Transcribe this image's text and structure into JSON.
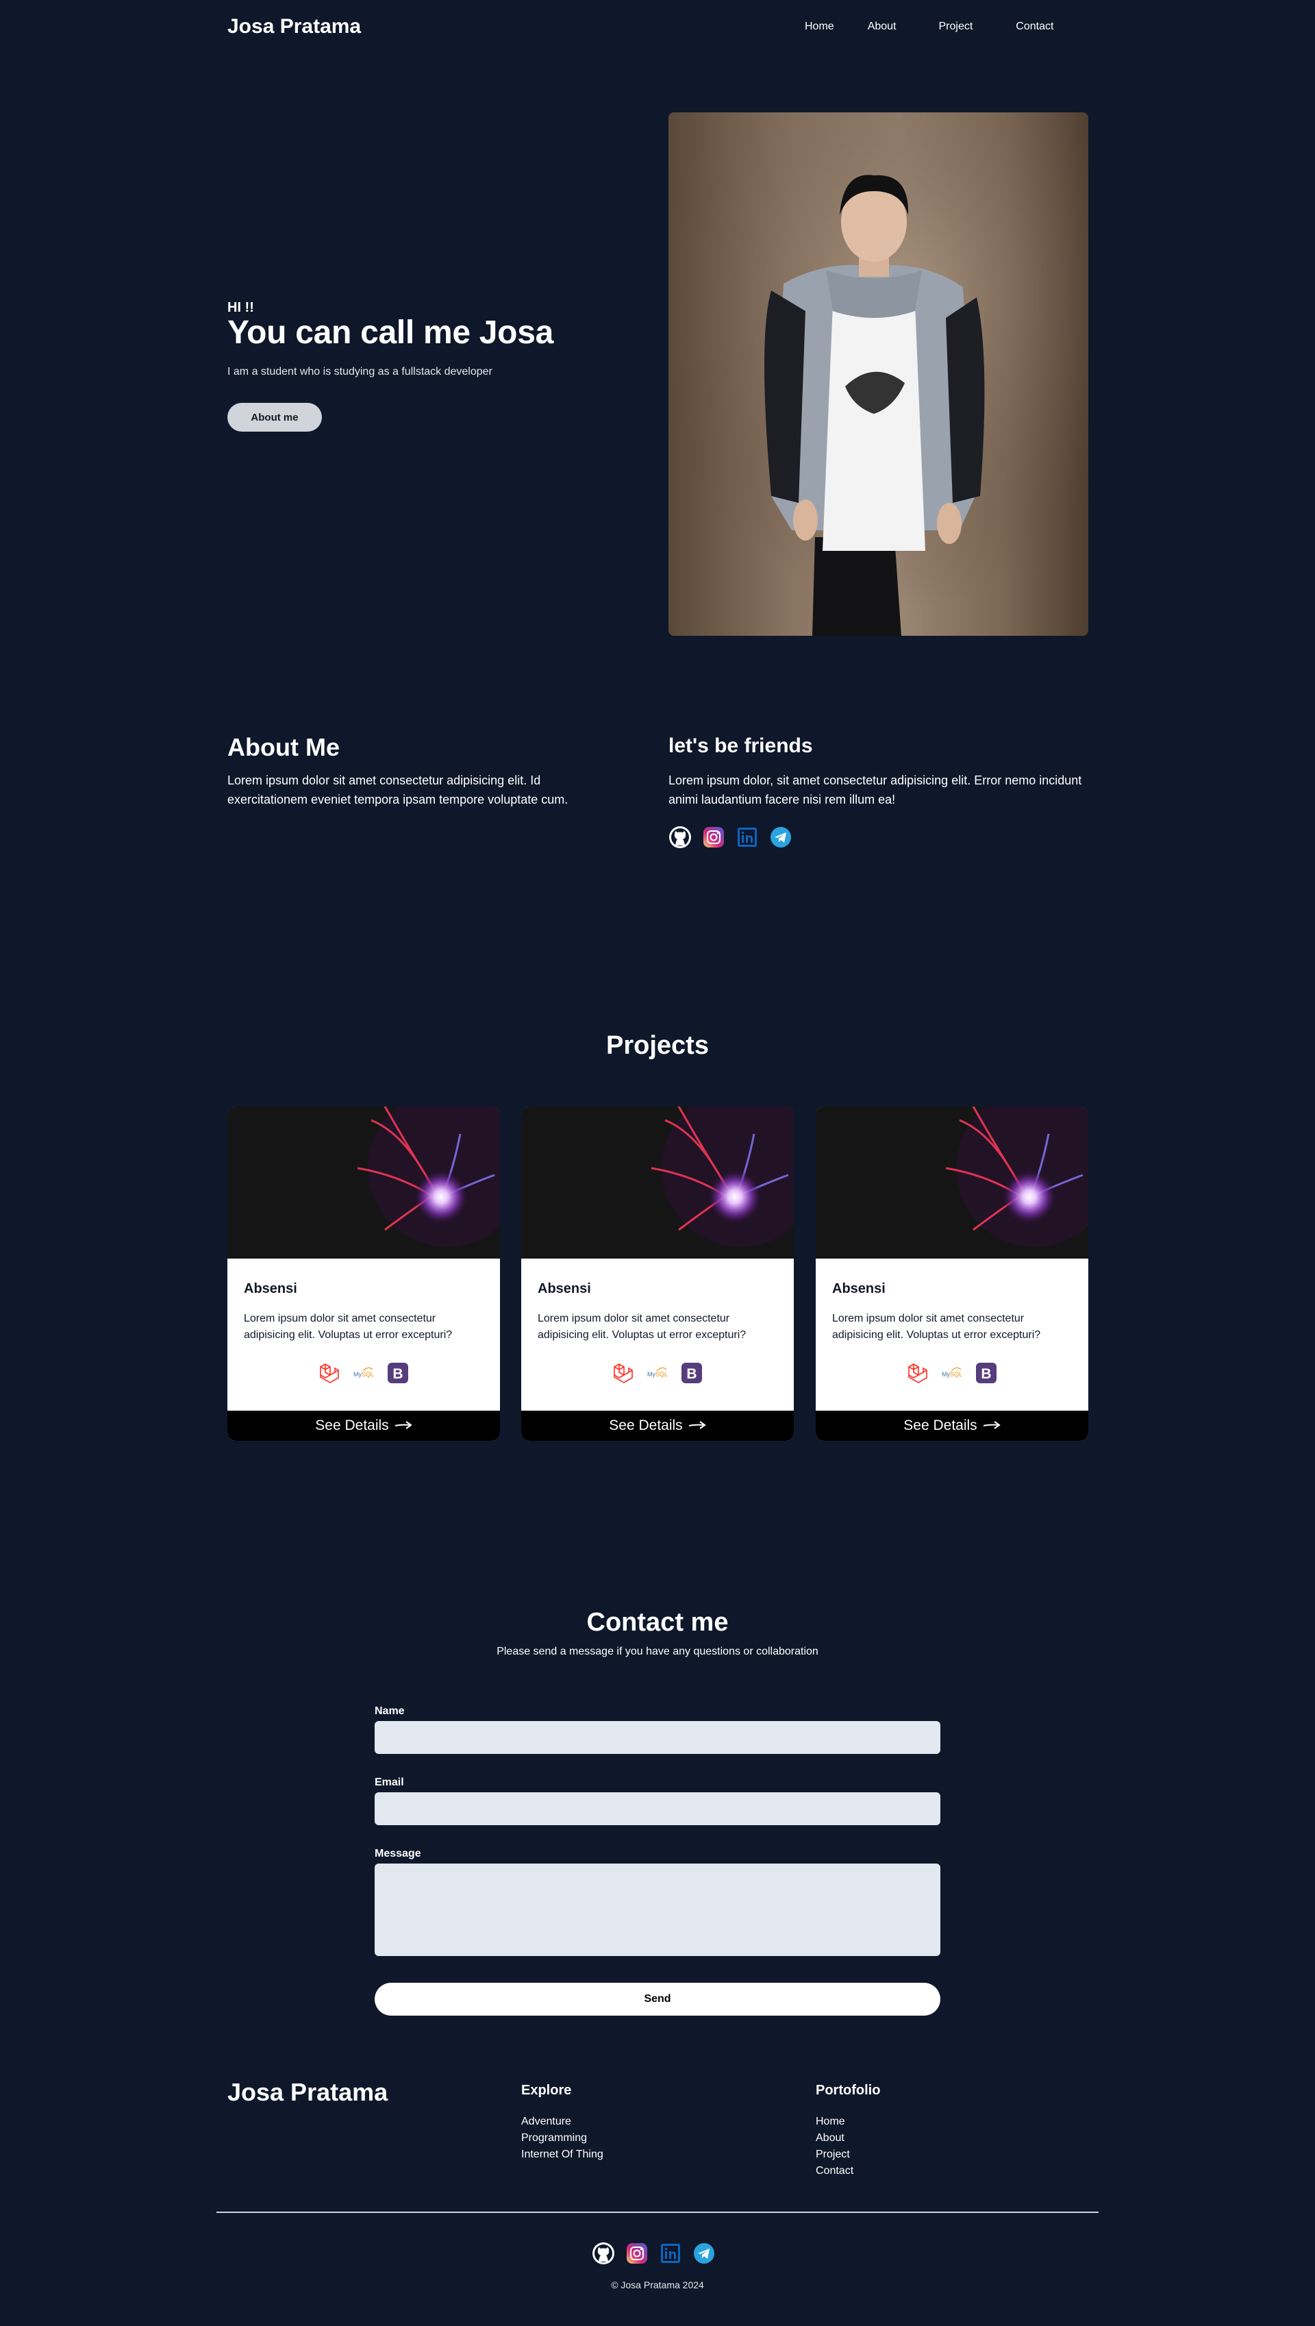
{
  "header": {
    "brand": "Josa Pratama",
    "nav": [
      "Home",
      "About",
      "Project",
      "Contact"
    ]
  },
  "hero": {
    "greeting": "HI !!",
    "headline": "You can call me Josa",
    "subtitle": "I am a student who is studying as a fullstack developer",
    "button": "About me"
  },
  "about": {
    "title": "About Me",
    "text": "Lorem ipsum dolor sit amet consectetur adipisicing elit. Id exercitationem eveniet tempora ipsam tempore voluptate cum.",
    "friends_title": "let's be friends",
    "friends_text": "Lorem ipsum dolor, sit amet consectetur adipisicing elit. Error nemo incidunt animi laudantium facere nisi rem illum ea!",
    "socials": [
      "github-icon",
      "instagram-icon",
      "linkedin-icon",
      "telegram-icon"
    ]
  },
  "projects": {
    "title": "Projects",
    "cards": [
      {
        "title": "Absensi",
        "desc": "Lorem ipsum dolor sit amet consectetur adipisicing elit. Voluptas ut error excepturi?",
        "details": "See Details",
        "tech": [
          "laravel-icon",
          "mysql-icon",
          "bootstrap-icon"
        ]
      },
      {
        "title": "Absensi",
        "desc": "Lorem ipsum dolor sit amet consectetur adipisicing elit. Voluptas ut error excepturi?",
        "details": "See Details",
        "tech": [
          "laravel-icon",
          "mysql-icon",
          "bootstrap-icon"
        ]
      },
      {
        "title": "Absensi",
        "desc": "Lorem ipsum dolor sit amet consectetur adipisicing elit. Voluptas ut error excepturi?",
        "details": "See Details",
        "tech": [
          "laravel-icon",
          "mysql-icon",
          "bootstrap-icon"
        ]
      }
    ]
  },
  "contact": {
    "title": "Contact me",
    "subtitle": "Please send a message if you have any questions or collaboration",
    "name_label": "Name",
    "email_label": "Email",
    "message_label": "Message",
    "name_value": "",
    "email_value": "",
    "message_value": "",
    "send": "Send"
  },
  "footer": {
    "brand": "Josa Pratama",
    "explore_title": "Explore",
    "explore": [
      "Adventure",
      "Programming",
      "Internet Of Thing"
    ],
    "portfolio_title": "Portofolio",
    "portfolio": [
      "Home",
      "About",
      "Project",
      "Contact"
    ],
    "copyright": "© Josa Pratama 2024"
  },
  "colors": {
    "background": "#0f172a",
    "input_bg": "#e2e8f0",
    "button_light": "#d1d5db",
    "card_footer": "#000000",
    "bootstrap": "#563d7c",
    "laravel": "#ff2d20",
    "linkedin": "#0a66c2",
    "telegram": "#2aa3de"
  }
}
